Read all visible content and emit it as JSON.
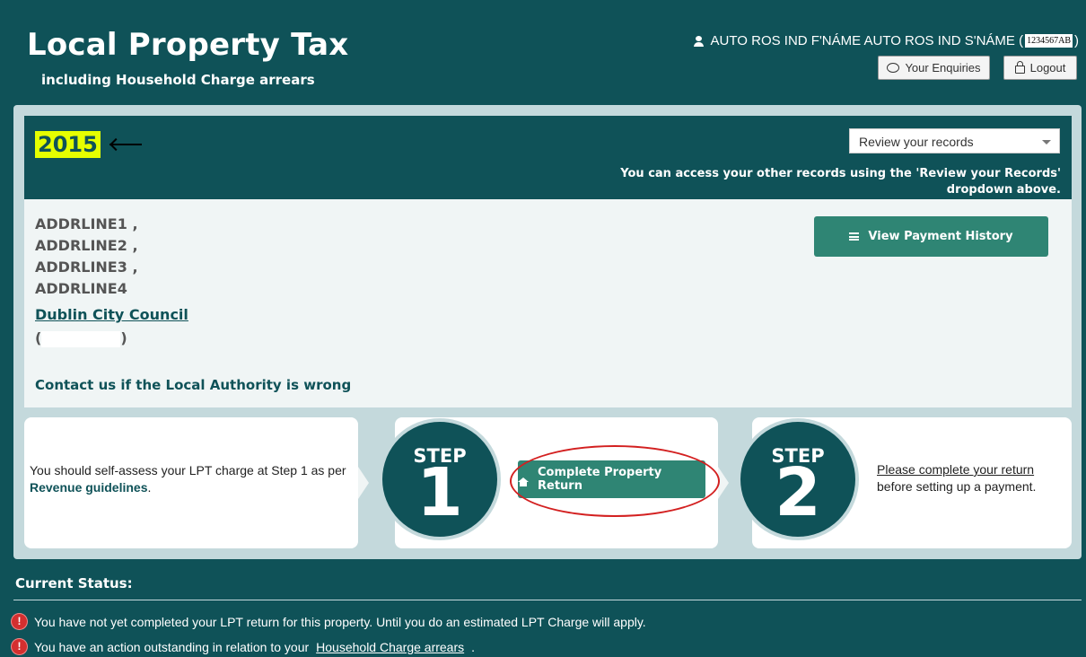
{
  "header": {
    "title": "Local Property Tax",
    "subtitle": "including Household Charge arrears",
    "user_name": "AUTO ROS IND F'NÁME AUTO ROS IND S'NÁME (",
    "user_pps": "1234567AB",
    "user_close": ")",
    "enquiries_label": "Your Enquiries",
    "logout_label": "Logout"
  },
  "year_bar": {
    "year": "2015",
    "records_select": "Review your records",
    "access_note": "You can access your other records using the 'Review your Records' dropdown above."
  },
  "property": {
    "address_lines": [
      "ADDRLINE1 ,",
      "ADDRLINE2 ,",
      "ADDRLINE3 ,",
      "ADDRLINE4"
    ],
    "local_authority": "Dublin City Council",
    "paren_open": "(",
    "paren_close": ")",
    "contact_link": "Contact us if the Local Authority is wrong",
    "payment_history_label": "View Payment History"
  },
  "steps": {
    "self_assess_text": "You should self-assess your LPT charge at Step 1 as per",
    "guidelines_link": "Revenue guidelines",
    "guidelines_end": ".",
    "step_label": "STEP",
    "step1_number": "1",
    "step2_number": "2",
    "complete_return_label": "Complete Property Return",
    "step2_link": "Please complete your return",
    "step2_text": "before setting up a payment."
  },
  "status": {
    "title": "Current Status:",
    "alert1": "You have not yet completed your LPT return for this property. Until you do an estimated LPT Charge will apply.",
    "alert2_prefix": "You have an action outstanding in relation to your",
    "alert2_link": "Household Charge arrears",
    "alert2_end": "."
  },
  "colors": {
    "brand_teal": "#0f5258",
    "button_green": "#2f8574",
    "year_highlight": "#e5ff00",
    "annotation_red": "#d32020"
  }
}
